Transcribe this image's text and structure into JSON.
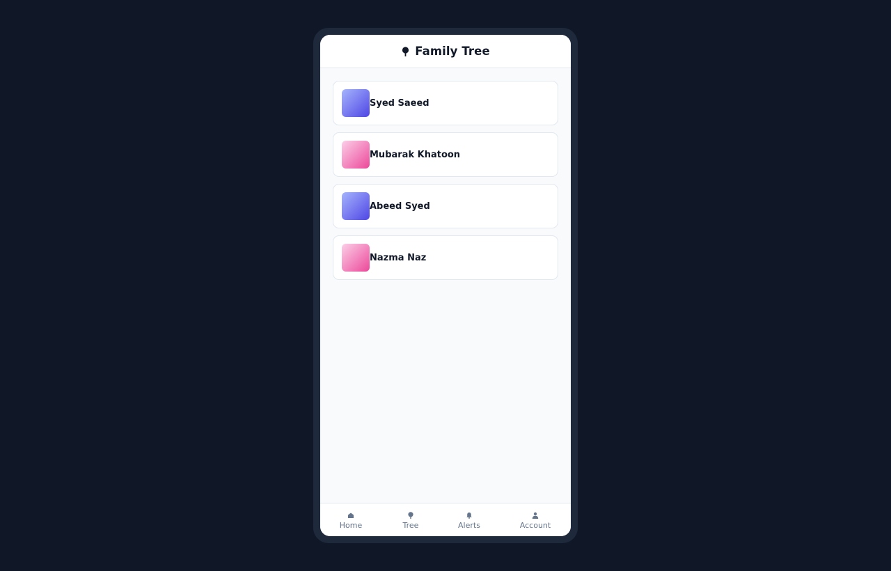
{
  "header": {
    "title": "Family Tree",
    "icon": "tree-icon"
  },
  "people": [
    {
      "name": "Syed Saeed",
      "gender": "male"
    },
    {
      "name": "Mubarak Khatoon",
      "gender": "female"
    },
    {
      "name": "Abeed Syed",
      "gender": "male"
    },
    {
      "name": "Nazma Naz",
      "gender": "female"
    }
  ],
  "tabs": [
    {
      "label": "Home",
      "icon": "home-icon"
    },
    {
      "label": "Tree",
      "icon": "tree-icon"
    },
    {
      "label": "Alerts",
      "icon": "bell-icon"
    },
    {
      "label": "Account",
      "icon": "user-icon"
    }
  ],
  "colors": {
    "background": "#101828",
    "device_frame": "#1e293b",
    "male_avatar": "#4f46e5",
    "female_avatar": "#ec4899",
    "tab_text": "#64748b"
  }
}
